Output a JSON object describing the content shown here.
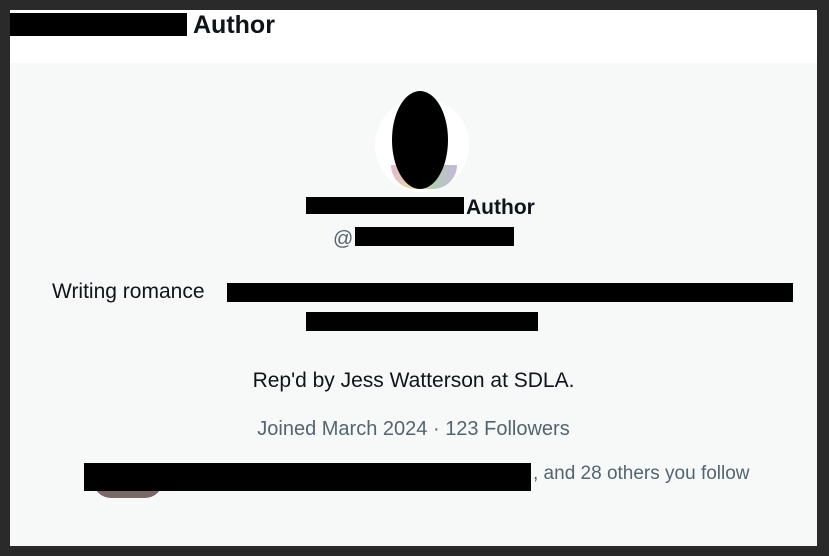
{
  "header": {
    "title": "Author"
  },
  "profile": {
    "display_name": "Author",
    "handle_prefix": "@",
    "bio": "Writing romance",
    "representation": "Rep'd by Jess Watterson at SDLA.",
    "joined": "Joined March 2024",
    "separator": "·",
    "followers": "123 Followers",
    "followers_you_know": ", and 28 others you follow"
  },
  "colors": {
    "primary_text": "#0f1419",
    "secondary_text": "#536471",
    "background": "#f7f9f9"
  }
}
